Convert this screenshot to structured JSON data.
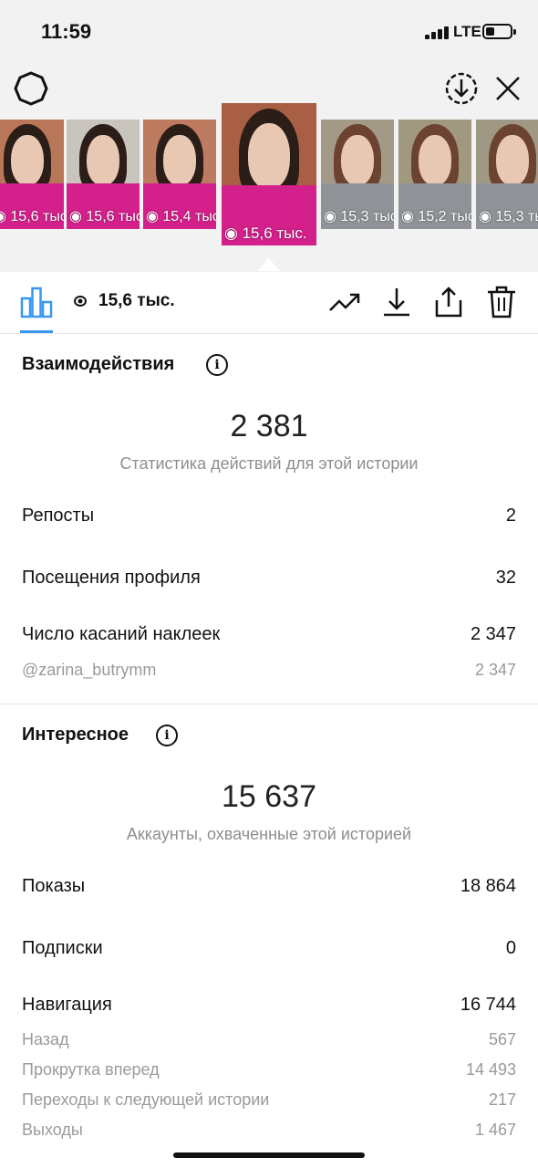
{
  "status_bar": {
    "time": "11:59",
    "network": "LTE"
  },
  "stories": [
    {
      "views": "15,6 тыс.",
      "active": false
    },
    {
      "views": "15,6 тыс.",
      "active": false
    },
    {
      "views": "15,4 тыс.",
      "active": false
    },
    {
      "views": "15,6 тыс.",
      "active": true
    },
    {
      "views": "15,3 тыс.",
      "active": false
    },
    {
      "views": "15,2 тыс.",
      "active": false
    },
    {
      "views": "15,3 тыс.",
      "active": false
    }
  ],
  "toolbar": {
    "views": "15,6 тыс.",
    "accent_color": "#3897f0"
  },
  "interactions": {
    "title": "Взаимодействия",
    "total": "2 381",
    "caption": "Статистика действий для этой истории",
    "rows": [
      {
        "label": "Репосты",
        "value": "2"
      },
      {
        "label": "Посещения профиля",
        "value": "32"
      },
      {
        "label": "Число касаний наклеек",
        "value": "2 347"
      }
    ],
    "sub_rows": [
      {
        "label": "@zarina_butrymm",
        "value": "2 347"
      }
    ]
  },
  "discovery": {
    "title": "Интересное",
    "total": "15 637",
    "caption": "Аккаунты, охваченные этой историей",
    "rows": [
      {
        "label": "Показы",
        "value": "18 864"
      },
      {
        "label": "Подписки",
        "value": "0"
      },
      {
        "label": "Навигация",
        "value": "16 744"
      }
    ],
    "sub_rows": [
      {
        "label": "Назад",
        "value": "567"
      },
      {
        "label": "Прокрутка вперед",
        "value": "14 493"
      },
      {
        "label": "Переходы к следующей истории",
        "value": "217"
      },
      {
        "label": "Выходы",
        "value": "1 467"
      }
    ]
  }
}
